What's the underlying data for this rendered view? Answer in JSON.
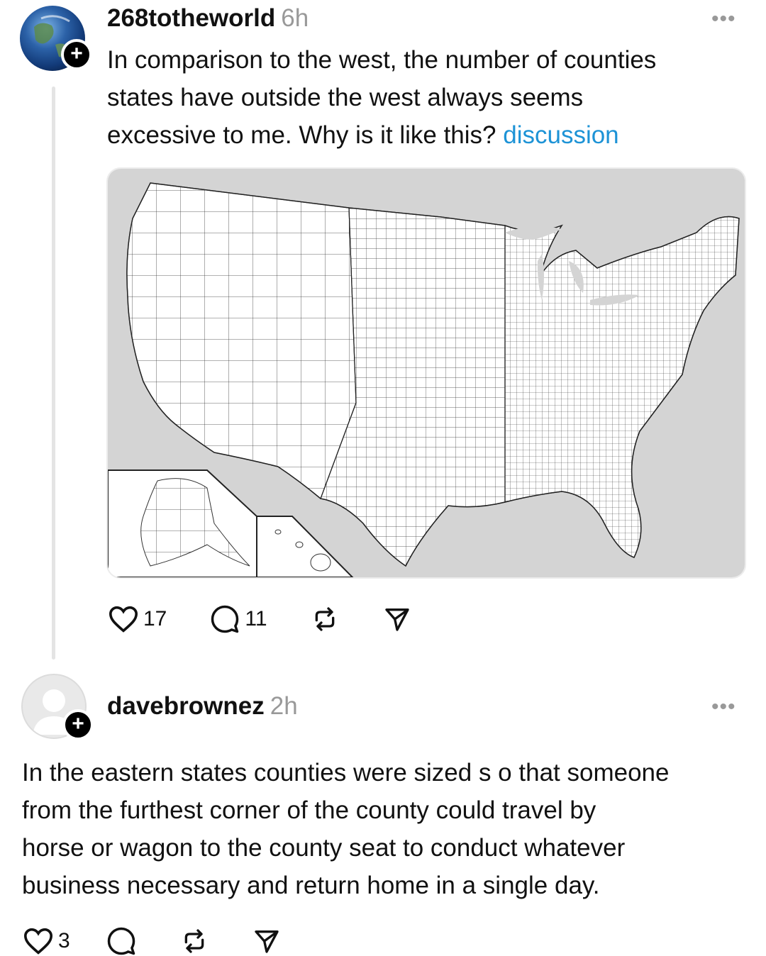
{
  "post": {
    "username": "268totheworld",
    "time": "6h",
    "more_label": "•••",
    "text_lines": [
      "In comparison to the west, the number of counties",
      "states have outside the west always seems",
      "excessive to me. Why is it like this? "
    ],
    "tag": "discussion",
    "image_icon": "us-county-map",
    "likes": "17",
    "replies": "11",
    "icons": [
      "heart-icon",
      "comment-icon",
      "repost-icon",
      "share-icon"
    ]
  },
  "reply": {
    "username": "davebrownez",
    "time": "2h",
    "more_label": "•••",
    "text_lines": [
      "In the eastern states counties were sized s o that someone",
      "from the furthest corner of the county could travel by",
      "horse or wagon to the county seat to conduct whatever",
      "business necessary and return home in a single day."
    ],
    "likes": "3",
    "icons": [
      "heart-icon",
      "comment-icon",
      "repost-icon",
      "share-icon"
    ]
  },
  "badge_label": "+",
  "colors": {
    "tag": "#1d93d6",
    "meta": "#999999",
    "land": "#ffffff",
    "water": "#d4d4d4"
  }
}
